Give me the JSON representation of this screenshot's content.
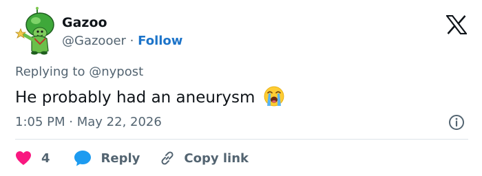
{
  "tweet": {
    "author": {
      "display_name": "Gazoo",
      "handle": "@Gazooer",
      "separator": "·",
      "follow_label": "Follow"
    },
    "replying_prefix": "Replying to ",
    "replying_to": "@nypost",
    "text": "He probably had an aneurysm",
    "emoji": "loudly-crying-face",
    "timestamp": {
      "time": "1:05 PM",
      "separator": "·",
      "date": "May 22, 2026"
    },
    "actions": {
      "like_count": "4",
      "reply_label": "Reply",
      "copy_label": "Copy link"
    }
  },
  "colors": {
    "text": "#0f1419",
    "secondary": "#536471",
    "follow": "#1d74c9",
    "like": "#f91880",
    "reply": "#1d9bf0",
    "divider": "#dde3e8"
  }
}
